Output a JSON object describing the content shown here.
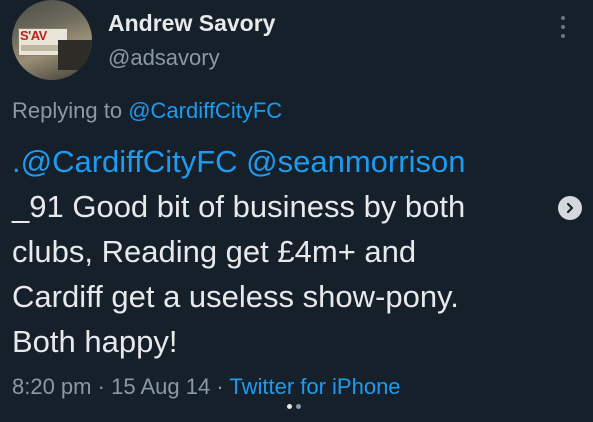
{
  "tweet": {
    "author_name": "Andrew Savory",
    "author_handle": "@adsavory",
    "replying_prefix": "Replying to",
    "replying_to": "@CardiffCityFC",
    "mention_1": ".@CardiffCityFC",
    "mention_2": "@seanmorrison",
    "line_2": "_91 Good bit of business by both",
    "line_3": "clubs, Reading get £4m+ and",
    "line_4": "Cardiff get a useless show-pony.",
    "line_5": "Both happy!",
    "time": "8:20 pm",
    "separator": "·",
    "date": "15 Aug 14",
    "source": "Twitter for iPhone"
  },
  "avatar": {
    "sign_text": "S'AV"
  },
  "icons": {
    "more": "more-vertical-icon",
    "next": "chevron-right-icon"
  },
  "colors": {
    "background": "#15202b",
    "text": "#e7e9ea",
    "muted": "#8b98a5",
    "link": "#1d9bf0"
  }
}
